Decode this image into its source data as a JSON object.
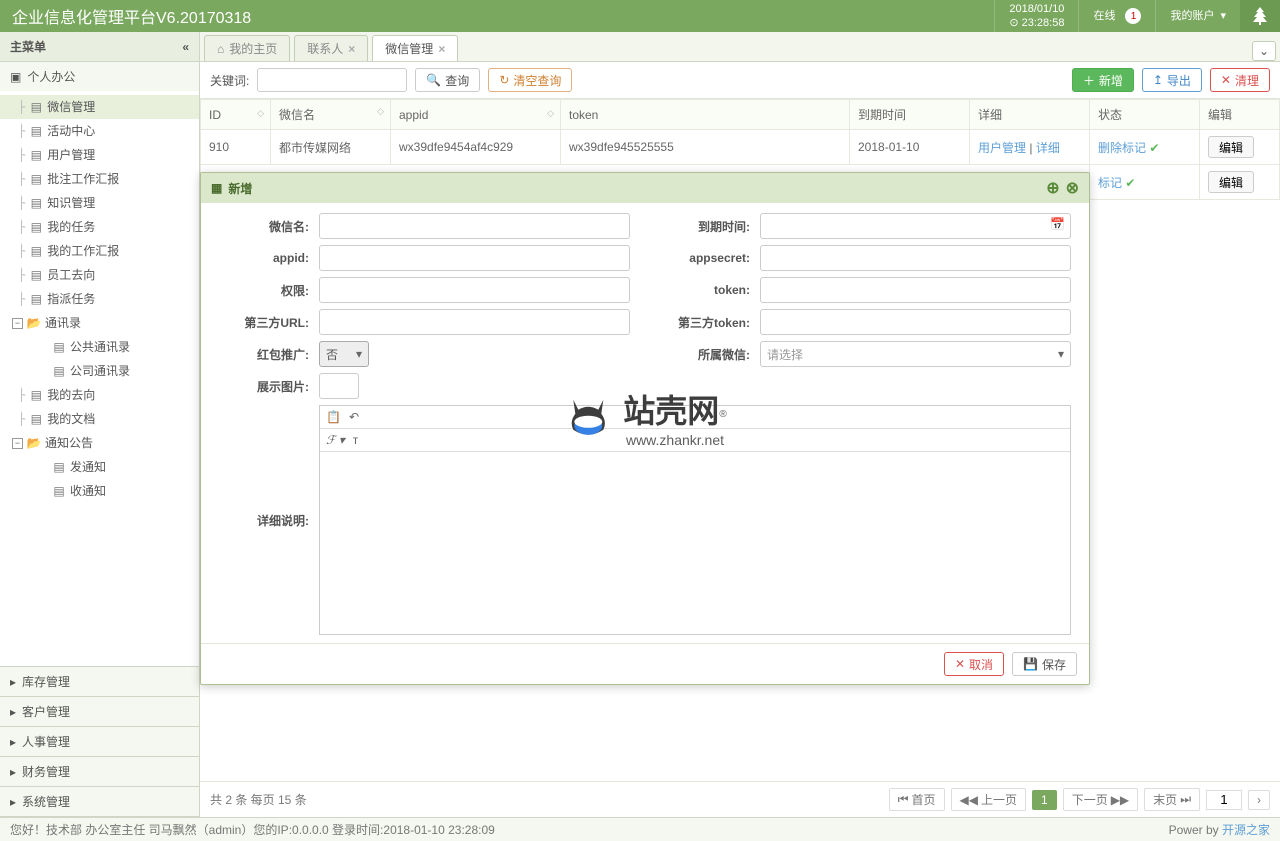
{
  "header": {
    "title": "企业信息化管理平台V6.20170318",
    "date": "2018/01/10",
    "time": "23:28:58",
    "online_label": "在线",
    "online_count": "1",
    "account_label": "我的账户"
  },
  "sidebar": {
    "title": "主菜单",
    "sections": [
      {
        "label": "个人办公"
      },
      {
        "label": "库存管理"
      },
      {
        "label": "客户管理"
      },
      {
        "label": "人事管理"
      },
      {
        "label": "财务管理"
      },
      {
        "label": "系统管理"
      }
    ],
    "tree": [
      {
        "label": "微信管理",
        "selected": true
      },
      {
        "label": "活动中心"
      },
      {
        "label": "用户管理"
      },
      {
        "label": "批注工作汇报"
      },
      {
        "label": "知识管理"
      },
      {
        "label": "我的任务"
      },
      {
        "label": "我的工作汇报"
      },
      {
        "label": "员工去向"
      },
      {
        "label": "指派任务"
      },
      {
        "label": "通讯录",
        "group": true,
        "children": [
          {
            "label": "公共通讯录"
          },
          {
            "label": "公司通讯录"
          }
        ]
      },
      {
        "label": "我的去向"
      },
      {
        "label": "我的文档"
      },
      {
        "label": "通知公告",
        "group": true,
        "children": [
          {
            "label": "发通知"
          },
          {
            "label": "收通知"
          }
        ]
      }
    ]
  },
  "tabs": [
    {
      "label": "我的主页",
      "home": true
    },
    {
      "label": "联系人",
      "closable": true
    },
    {
      "label": "微信管理",
      "closable": true,
      "active": true
    }
  ],
  "toolbar": {
    "keyword_label": "关键词:",
    "search": "查询",
    "clear": "清空查询",
    "add": "新增",
    "export": "导出",
    "clean": "清理"
  },
  "table": {
    "headers": [
      "ID",
      "微信名",
      "appid",
      "token",
      "到期时间",
      "详细",
      "状态",
      "编辑"
    ],
    "rows": [
      {
        "id": "910",
        "name": "都市传媒网络",
        "appid": "wx39dfe9454af4c929",
        "token": "wx39dfe945525555",
        "expire": "2018-01-10",
        "detail1": "用户管理",
        "detail2": "详细",
        "status": "删除标记",
        "edit": "编辑"
      },
      {
        "status2": "标记",
        "edit2": "编辑"
      }
    ]
  },
  "pagination": {
    "summary": "共 2 条 每页 15 条",
    "first": "首页",
    "prev": "上一页",
    "current": "1",
    "next": "下一页",
    "last": "末页",
    "goto": "1"
  },
  "modal": {
    "title": "新增",
    "labels": {
      "wxname": "微信名:",
      "expire": "到期时间:",
      "appid": "appid:",
      "appsecret": "appsecret:",
      "perm": "权限:",
      "token": "token:",
      "url3": "第三方URL:",
      "token3": "第三方token:",
      "redpkg": "红包推广:",
      "belong": "所属微信:",
      "showimg": "展示图片:",
      "desc": "详细说明:"
    },
    "redpkg_value": "否",
    "belong_placeholder": "请选择",
    "cancel": "取消",
    "save": "保存"
  },
  "watermark": {
    "text": "站壳网",
    "url": "www.zhankr.net",
    "reg": "®"
  },
  "footer": {
    "greeting": "您好！技术部 办公室主任 司马飘然（admin）您的IP:0.0.0.0 登录时间:2018-01-10 23:28:09",
    "power": "Power by ",
    "power_link": "开源之家"
  }
}
